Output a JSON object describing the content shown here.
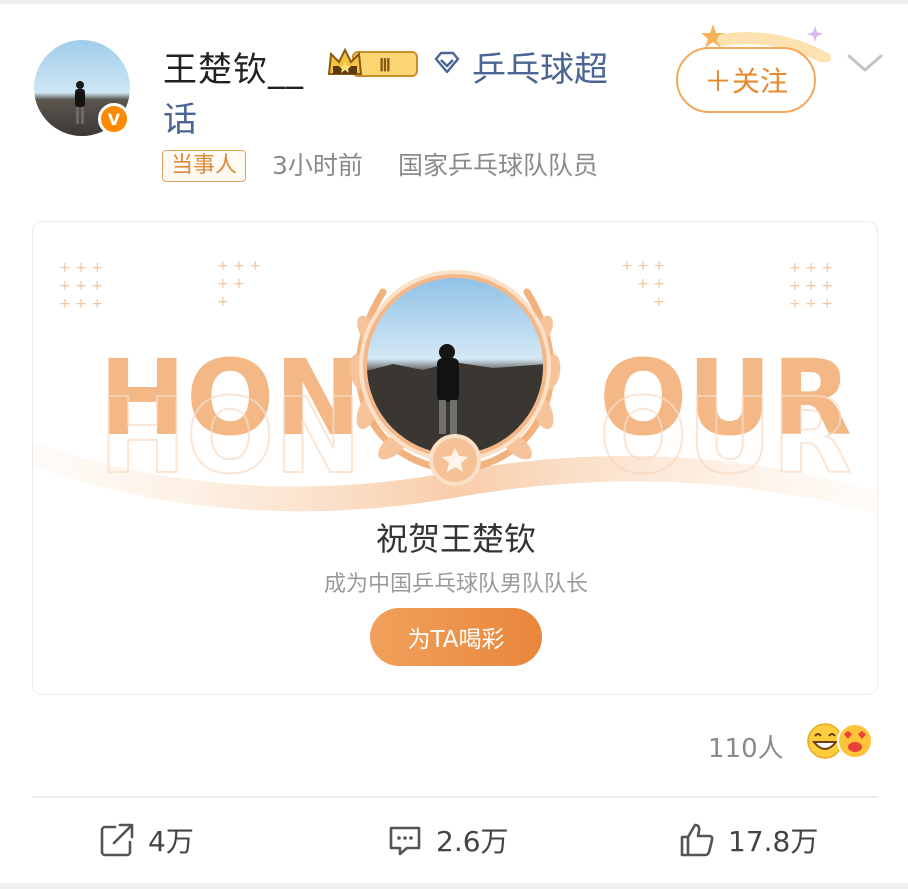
{
  "post": {
    "username": "王楚钦__",
    "crown_level": "Ⅲ",
    "topic_line1": "乒乓球超",
    "topic_line2": "话",
    "tag": "当事人",
    "time": "3小时前",
    "description": "国家乒乓球队队员",
    "follow_label": "＋关注",
    "verified_mark": "V"
  },
  "card": {
    "honour_left": "HON",
    "honour_right": "OUR",
    "title": "祝贺王楚钦",
    "subtitle": "成为中国乒乓球队男队队长",
    "cheer_label": "为TA喝彩"
  },
  "reactions": {
    "count": "110人",
    "icons": [
      "laughing-emoji-icon",
      "heart-eyes-emoji-icon"
    ]
  },
  "actions": {
    "share": "4万",
    "comment": "2.6万",
    "like": "17.8万"
  },
  "colors": {
    "accent_orange": "#e9863b",
    "topic_blue": "#4a6494",
    "honour_orange": "#f4b887"
  }
}
